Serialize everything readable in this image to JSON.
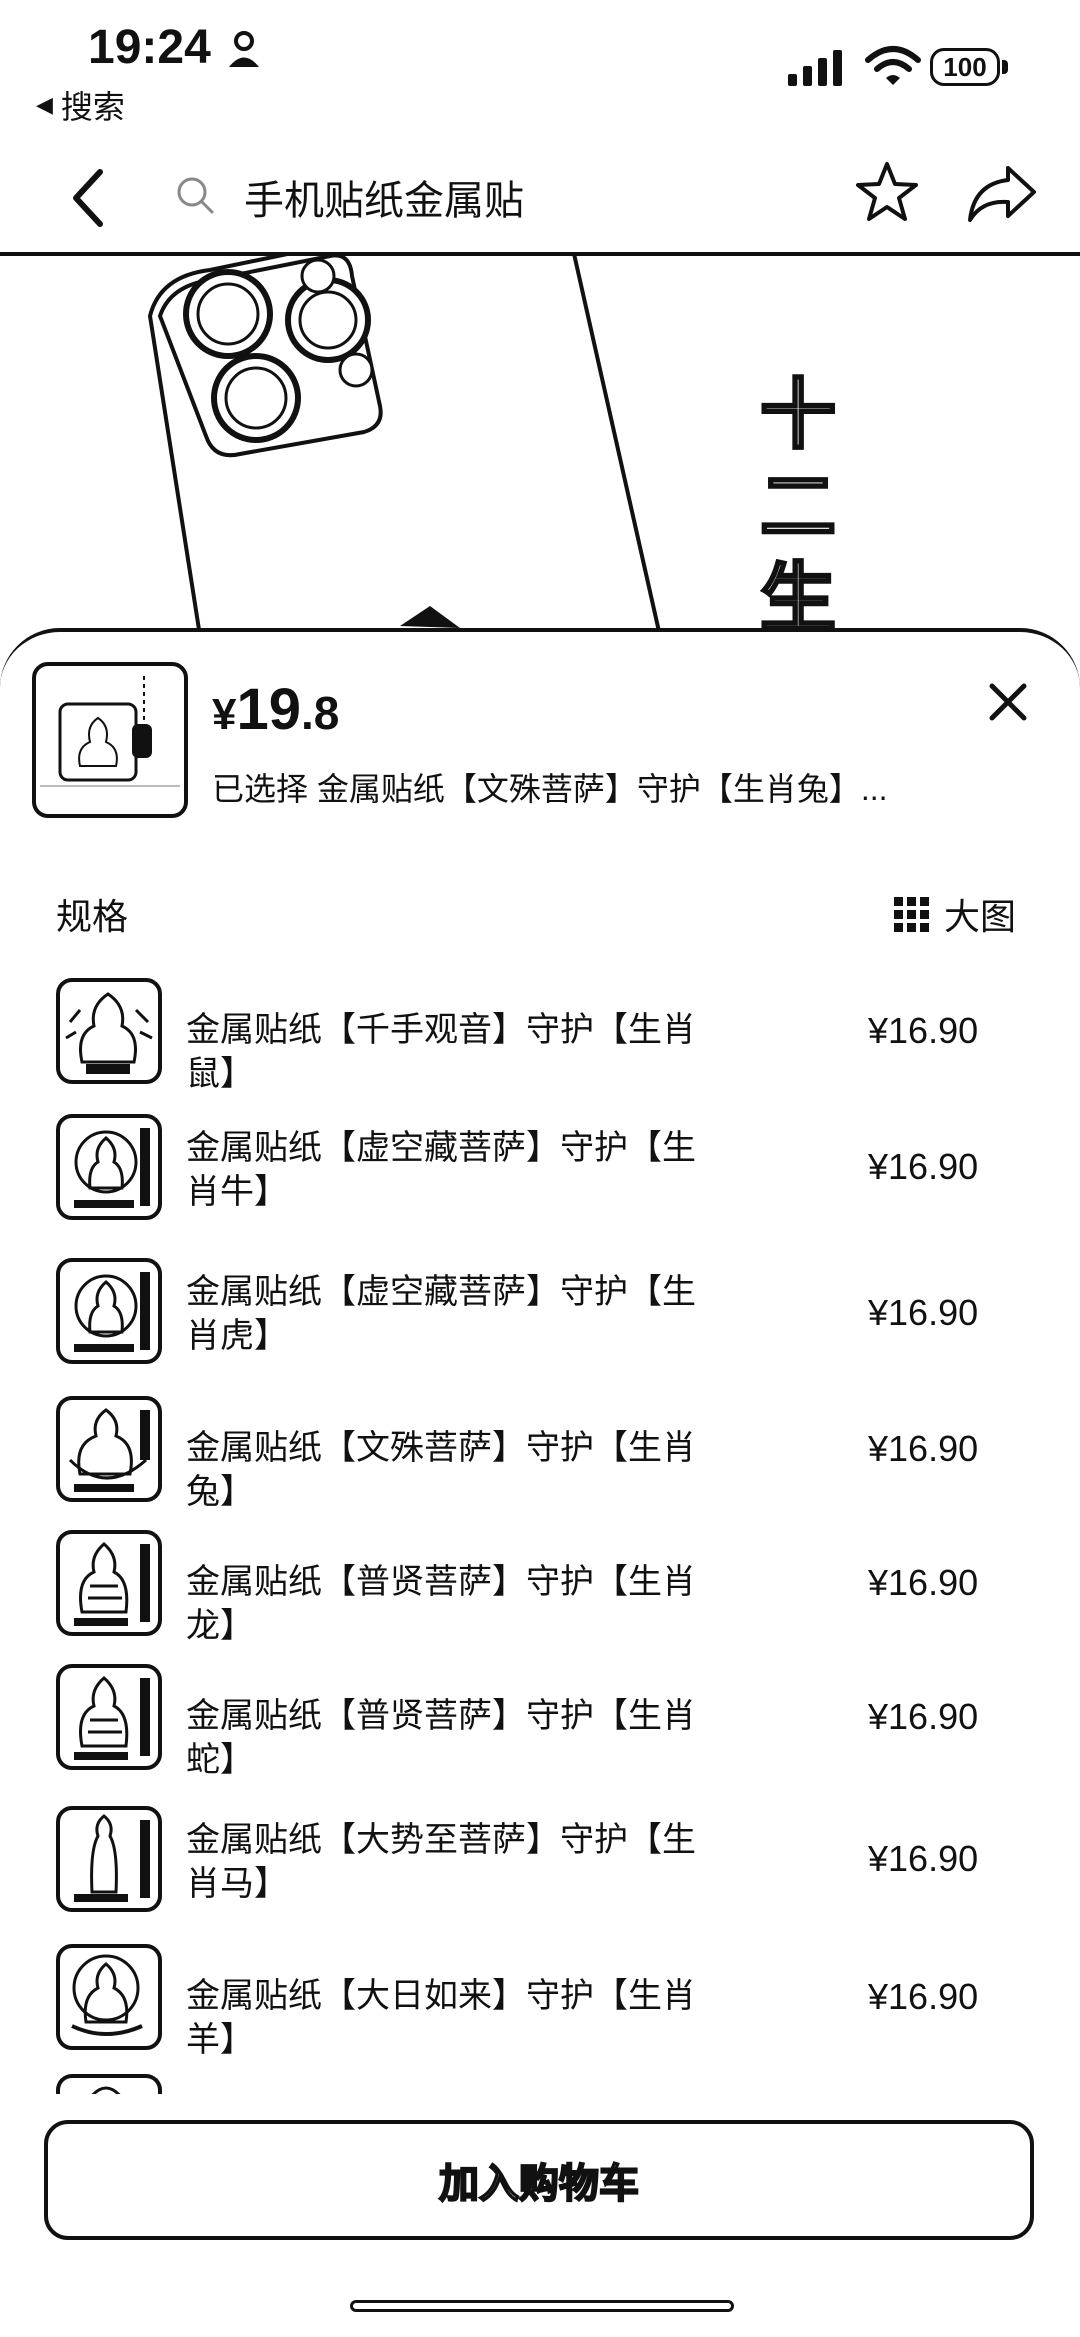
{
  "status": {
    "time": "19:24",
    "back_app": "搜索",
    "battery": "100"
  },
  "nav": {
    "search_query": "手机贴纸金属贴"
  },
  "hero": {
    "zodiac_text": [
      "十",
      "二",
      "生"
    ]
  },
  "sheet": {
    "price_currency": "¥",
    "price_int": "19",
    "price_dec": ".8",
    "selected_text": "已选择 金属贴纸【文殊菩萨】守护【生肖兔】...",
    "spec_label": "规格",
    "big_view_label": "大图",
    "items": [
      {
        "name": "金属贴纸【千手观音】守护【生肖鼠】",
        "price": "¥16.90"
      },
      {
        "name": "金属贴纸【虚空藏菩萨】守护【生肖牛】",
        "price": "¥16.90"
      },
      {
        "name": "金属贴纸【虚空藏菩萨】守护【生肖虎】",
        "price": "¥16.90"
      },
      {
        "name": "金属贴纸【文殊菩萨】守护【生肖兔】",
        "price": "¥16.90"
      },
      {
        "name": "金属贴纸【普贤菩萨】守护【生肖龙】",
        "price": "¥16.90"
      },
      {
        "name": "金属贴纸【普贤菩萨】守护【生肖蛇】",
        "price": "¥16.90"
      },
      {
        "name": "金属贴纸【大势至菩萨】守护【生肖马】",
        "price": "¥16.90"
      },
      {
        "name": "金属贴纸【大日如来】守护【生肖羊】",
        "price": "¥16.90"
      }
    ],
    "add_to_cart": "加入购物车"
  }
}
